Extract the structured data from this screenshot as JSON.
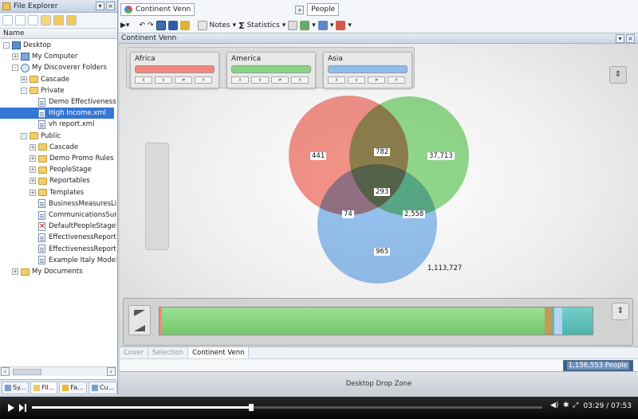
{
  "left_pane": {
    "title": "File Explorer",
    "column_header": "Name",
    "tree": [
      {
        "label": "Desktop",
        "indent": 0,
        "icon": "desktop-icon",
        "pm": "-"
      },
      {
        "label": "My Computer",
        "indent": 1,
        "icon": "computer-icon",
        "pm": "+"
      },
      {
        "label": "My Discoverer Folders",
        "indent": 1,
        "icon": "discoverer-icon",
        "pm": "-"
      },
      {
        "label": "Cascade",
        "indent": 2,
        "icon": "folder-icon",
        "pm": "+"
      },
      {
        "label": "Private",
        "indent": 2,
        "icon": "folder-icon",
        "pm": "-"
      },
      {
        "label": "Demo Effectiveness Re",
        "indent": 3,
        "icon": "report-icon",
        "pm": ""
      },
      {
        "label": "High Income.xml",
        "indent": 3,
        "icon": "report-icon",
        "pm": "",
        "selected": true
      },
      {
        "label": "vh report.xml",
        "indent": 3,
        "icon": "report-icon",
        "pm": ""
      },
      {
        "label": "Public",
        "indent": 2,
        "icon": "folder-icon",
        "pm": "-"
      },
      {
        "label": "Cascade",
        "indent": 3,
        "icon": "folder-icon",
        "pm": "+"
      },
      {
        "label": "Demo Promo Rules",
        "indent": 3,
        "icon": "folder-icon",
        "pm": "+"
      },
      {
        "label": "PeopleStage",
        "indent": 3,
        "icon": "folder-icon",
        "pm": "+"
      },
      {
        "label": "Reportables",
        "indent": 3,
        "icon": "folder-icon",
        "pm": "+"
      },
      {
        "label": "Templates",
        "indent": 3,
        "icon": "folder-icon",
        "pm": "+"
      },
      {
        "label": "BusinessMeasuresLibra",
        "indent": 3,
        "icon": "report-icon",
        "pm": ""
      },
      {
        "label": "CommunicationsSumm",
        "indent": 3,
        "icon": "report-icon",
        "pm": ""
      },
      {
        "label": "DefaultPeopleStageDia",
        "indent": 3,
        "icon": "error-doc-icon",
        "pm": ""
      },
      {
        "label": "EffectivenessReport.xn",
        "indent": 3,
        "icon": "report-icon",
        "pm": ""
      },
      {
        "label": "EffectivenessReport-W",
        "indent": 3,
        "icon": "report-icon",
        "pm": ""
      },
      {
        "label": "Example Italy Modellin",
        "indent": 3,
        "icon": "report-icon",
        "pm": ""
      },
      {
        "label": "My Documents",
        "indent": 1,
        "icon": "folder-icon",
        "pm": "+"
      }
    ],
    "tabs": [
      {
        "label": "Sy...",
        "icon": "system-icon"
      },
      {
        "label": "Fil...",
        "icon": "folder-icon"
      },
      {
        "label": "Fa...",
        "icon": "star-icon"
      },
      {
        "label": "Cu...",
        "icon": "custom-icon"
      }
    ]
  },
  "header": {
    "document_title": "Continent Venn",
    "table_name": "People",
    "notes_label": "Notes",
    "statistics_label": "Statistics",
    "sigma": "Σ"
  },
  "venn_window_title": "Continent Venn",
  "filters": [
    {
      "label": "Africa",
      "color": "#f4877c"
    },
    {
      "label": "America",
      "color": "#86d67f"
    },
    {
      "label": "Asia",
      "color": "#8cbcf0"
    }
  ],
  "venn": {
    "africa_only": "441",
    "america_only": "37,713",
    "asia_only": "965",
    "africa_america": "782",
    "africa_asia": "74",
    "america_asia": "2,558",
    "all_three": "293",
    "outside": "1,113,727"
  },
  "bottom_tabs": [
    "Cover",
    "Selection",
    "Continent Venn"
  ],
  "status_count": "1,156,553 People",
  "drop_zone": "Desktop Drop Zone",
  "video": {
    "time": "03:29 / 07:53",
    "progress": 0.43
  }
}
